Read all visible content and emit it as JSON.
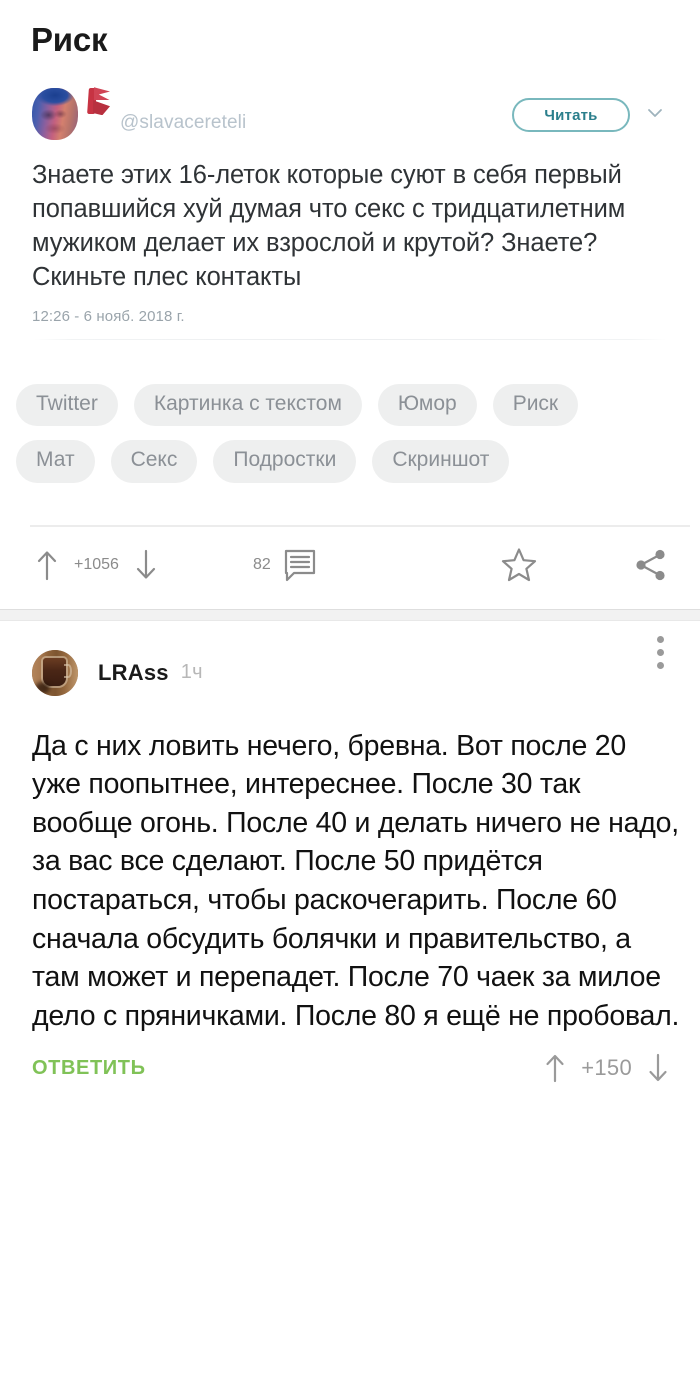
{
  "post": {
    "title": "Риск",
    "tweet": {
      "handle": "@slavacereteli",
      "read_button": "Читать",
      "text": "Знаете этих 16-леток которые суют в себя первый попавшийся хуй думая что секс с тридцатилетним мужиком делает их взрослой и крутой? Знаете? Скиньте плес контакты",
      "timestamp": "12:26 - 6 нояб. 2018 г.",
      "avatar_icon": "twitter-avatar-face",
      "badge_icon": "verified-badge-icon",
      "chevron_icon": "chevron-down-icon"
    },
    "tags": [
      "Twitter",
      "Картинка с текстом",
      "Юмор",
      "Риск",
      "Мат",
      "Секс",
      "Подростки",
      "Скриншот"
    ],
    "actions": {
      "upvote_icon": "arrow-up-icon",
      "rating": "+1056",
      "downvote_icon": "arrow-down-icon",
      "comment_count": "82",
      "comment_icon": "comment-icon",
      "favorite_icon": "star-icon",
      "share_icon": "share-icon"
    }
  },
  "comment": {
    "avatar_icon": "user-avatar-mug",
    "username": "LRAss",
    "time": "1ч",
    "menu_icon": "more-vertical-icon",
    "text": "Да с них ловить нечего, бревна. Вот после 20 уже поопытнее, интереснее. После 30 так вообще огонь. После 40 и делать ничего не надо, за вас все сделают. После 50 придётся постараться, чтобы раскочегарить. После 60 сначала обсудить болячки и правительство, а там может и перепадет. После 70 чаек за милое дело с пряничками. После 80 я ещё не пробовал.",
    "reply_label": "ОТВЕТИТЬ",
    "rating": "+150",
    "upvote_icon": "arrow-up-icon",
    "downvote_icon": "arrow-down-icon"
  },
  "colors": {
    "reply_green": "#80c257",
    "read_button_teal": "#2b7f8c",
    "tag_bg": "#eeefef",
    "tag_text": "#8b9096",
    "action_gray": "#8b8b8b"
  }
}
